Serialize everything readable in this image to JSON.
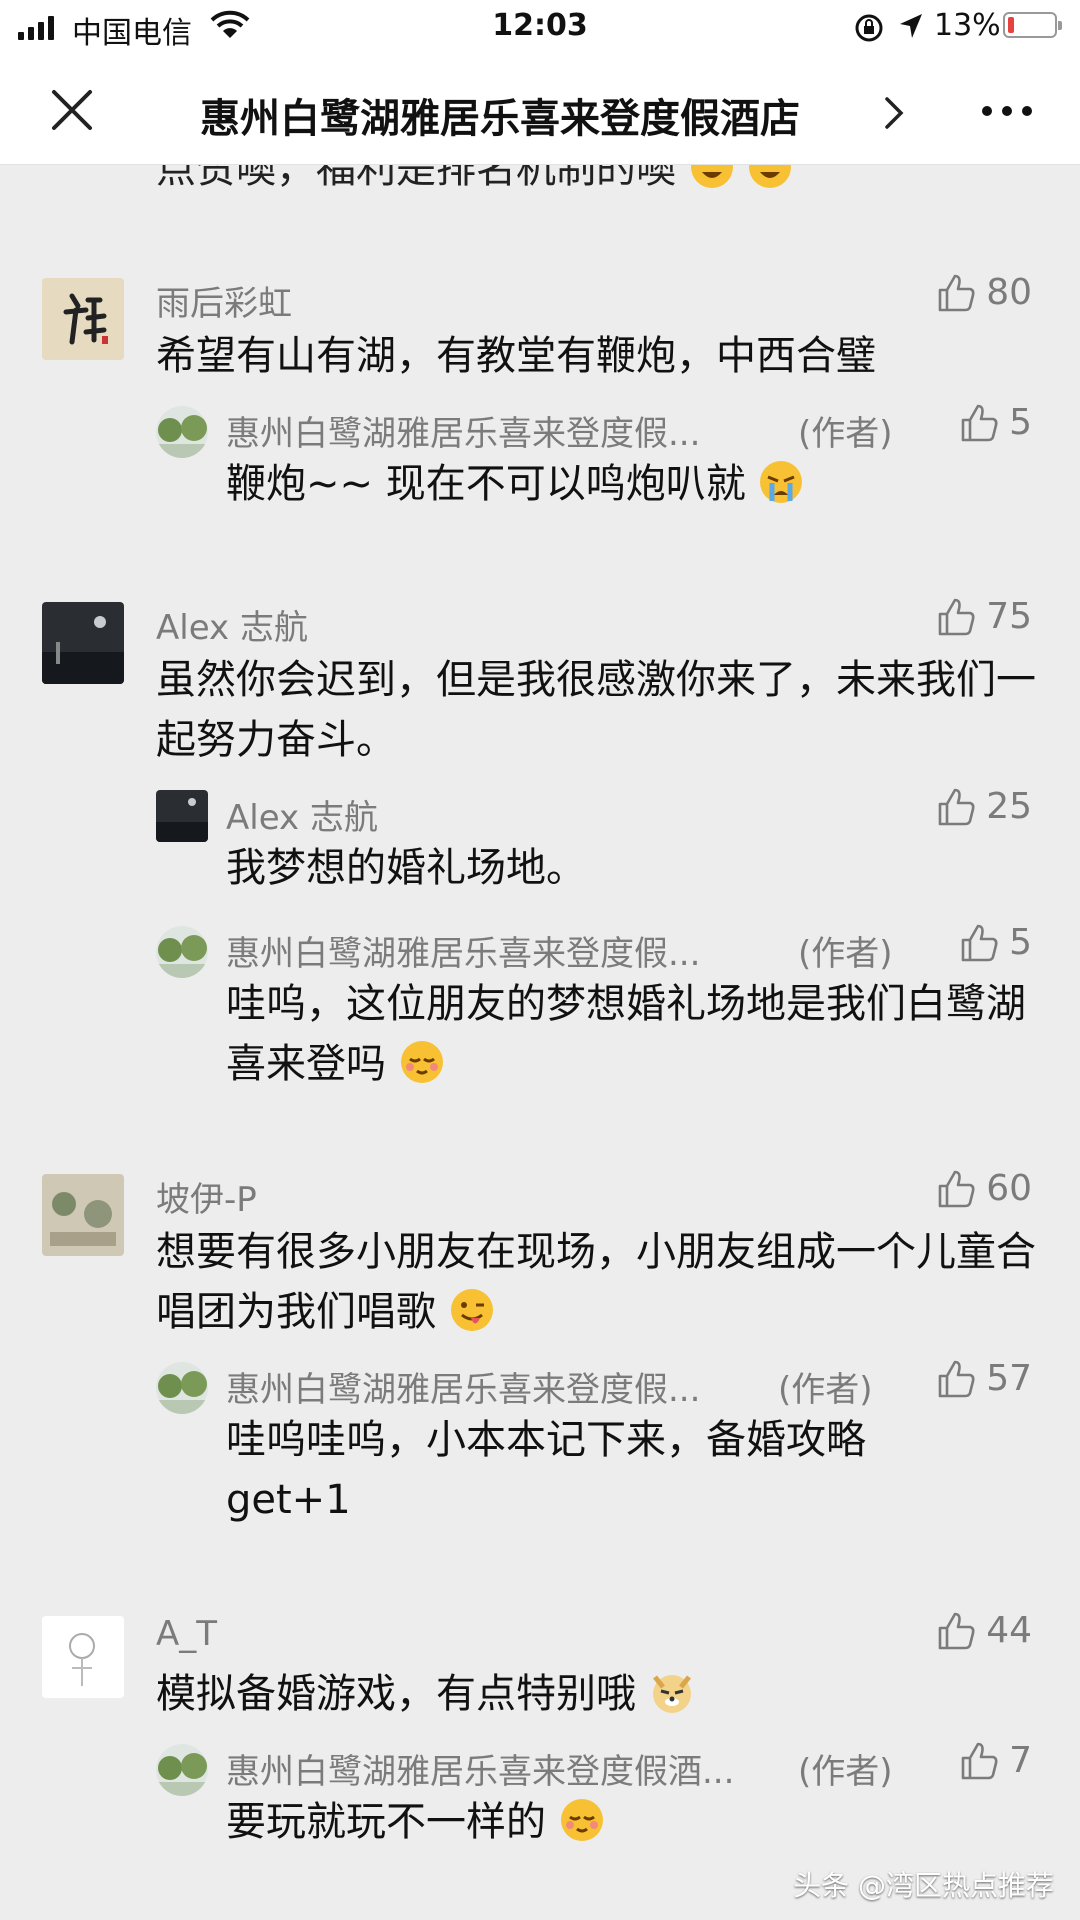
{
  "status_bar": {
    "carrier": "中国电信",
    "time": "12:03",
    "battery": "13%"
  },
  "nav": {
    "title": "惠州白鹭湖雅居乐喜来登度假酒店"
  },
  "previous_comment_tail": "点赞噢，福利是排名机制的噢",
  "comments": [
    {
      "author": "雨后彩虹",
      "likes": "80",
      "text": "希望有山有湖，有教堂有鞭炮，中西合璧",
      "replies": [
        {
          "author": "惠州白鹭湖雅居乐喜来登度假...",
          "tag": "(作者)",
          "likes": "5",
          "text": "鞭炮~~ 现在不可以鸣炮叭就"
        }
      ]
    },
    {
      "author": "Alex 志航",
      "likes": "75",
      "text": "虽然你会迟到，但是我很感激你来了，未来我们一起努力奋斗。",
      "replies": [
        {
          "author": "Alex 志航",
          "tag": "",
          "likes": "25",
          "text": "我梦想的婚礼场地。"
        },
        {
          "author": "惠州白鹭湖雅居乐喜来登度假...",
          "tag": "(作者)",
          "likes": "5",
          "text": "哇呜，这位朋友的梦想婚礼场地是我们白鹭湖喜来登吗"
        }
      ]
    },
    {
      "author": "坡伊-P",
      "likes": "60",
      "text": "想要有很多小朋友在现场，小朋友组成一个儿童合唱团为我们唱歌",
      "replies": [
        {
          "author": "惠州白鹭湖雅居乐喜来登度假...",
          "tag": "(作者)",
          "likes": "57",
          "text": "哇呜哇呜，小本本记下来，备婚攻略get+1"
        }
      ]
    },
    {
      "author": "A_T",
      "likes": "44",
      "text": "模拟备婚游戏，有点特别哦",
      "replies": [
        {
          "author": "惠州白鹭湖雅居乐喜来登度假酒...",
          "tag": "(作者)",
          "likes": "7",
          "text": "要玩就玩不一样的"
        }
      ]
    }
  ],
  "watermark": "头条 @湾区热点推荐"
}
